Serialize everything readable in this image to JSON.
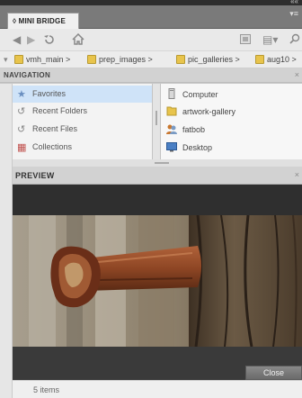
{
  "panel": {
    "tab_title": "◊ MINI BRIDGE",
    "collapse_glyph": "««",
    "menu_glyph": "▾≡"
  },
  "toolbar": {
    "icons": [
      "back-arrow-icon",
      "forward-arrow-icon",
      "recent-icon",
      "home-icon",
      "view-icon",
      "list-icon",
      "search-icon"
    ]
  },
  "path": {
    "items": [
      "vmh_main",
      "prep_images",
      "pic_galleries",
      "aug10"
    ],
    "separator": ">"
  },
  "navigation": {
    "title": "NAVIGATION",
    "left_items": [
      {
        "label": "Favorites",
        "icon": "star-icon",
        "selected": true
      },
      {
        "label": "Recent Folders",
        "icon": "recent-folders-icon",
        "selected": false
      },
      {
        "label": "Recent Files",
        "icon": "recent-files-icon",
        "selected": false
      },
      {
        "label": "Collections",
        "icon": "collections-icon",
        "selected": false
      }
    ],
    "right_items": [
      {
        "label": "Computer",
        "icon": "computer-icon"
      },
      {
        "label": "artwork-gallery",
        "icon": "folder-icon"
      },
      {
        "label": "fatbob",
        "icon": "user-icon"
      },
      {
        "label": "Desktop",
        "icon": "desktop-icon"
      }
    ]
  },
  "preview": {
    "title": "PREVIEW",
    "close_label": "Close"
  },
  "status": {
    "items_count": "5 items"
  },
  "colors": {
    "selection": "#cfe3f8",
    "folder": "#e8c44c",
    "preview_bg": "#2f2f2f"
  }
}
